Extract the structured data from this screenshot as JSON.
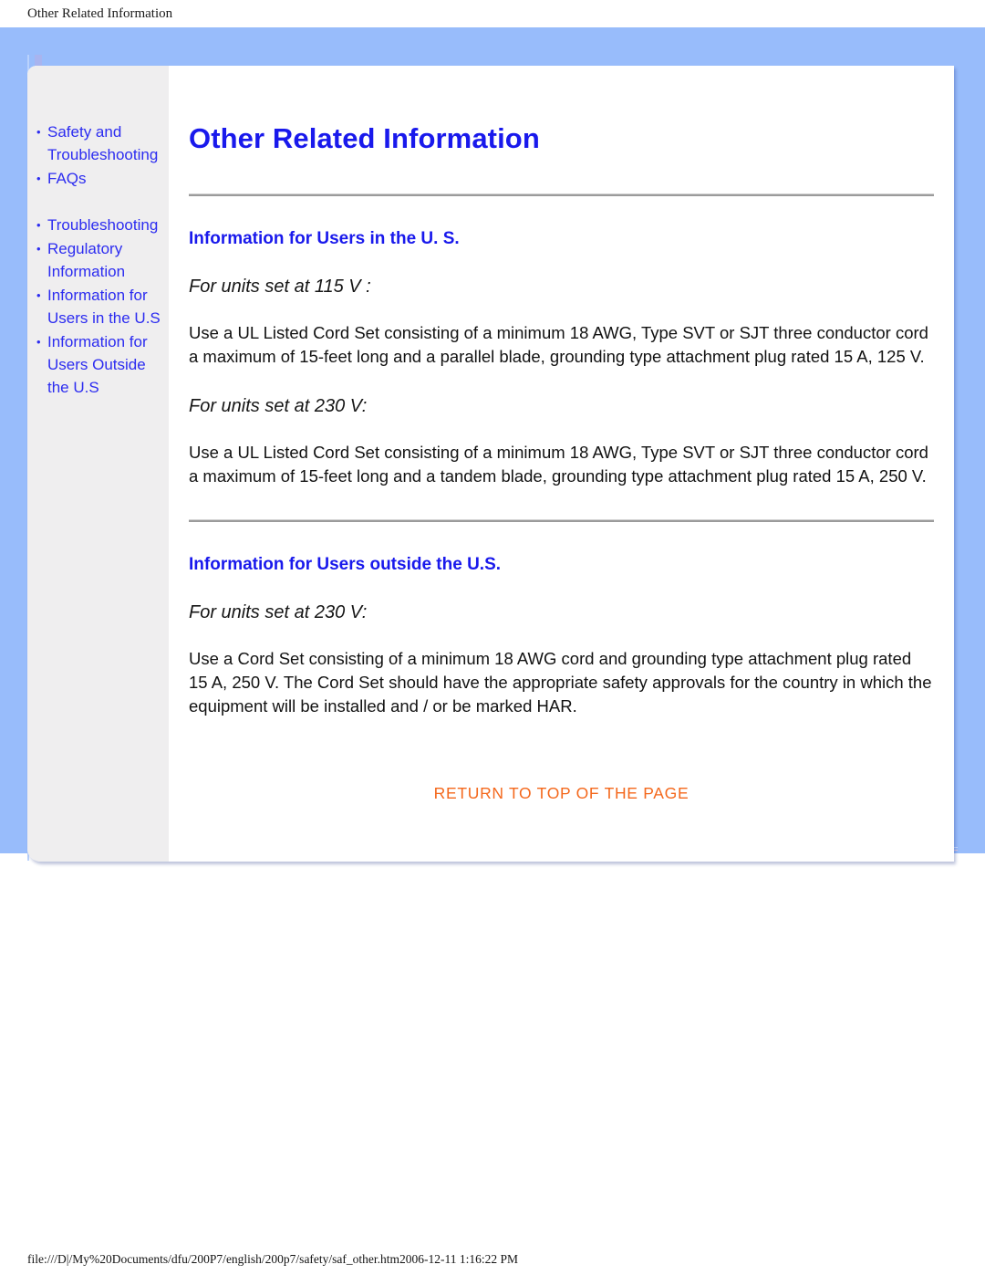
{
  "print_header": {
    "title": "Other Related Information"
  },
  "sidebar": {
    "groups": [
      {
        "items": [
          {
            "label": "Safety and Troubleshooting"
          },
          {
            "label": "FAQs"
          }
        ]
      },
      {
        "items": [
          {
            "label": "Troubleshooting"
          },
          {
            "label": "Regulatory Information"
          },
          {
            "label": "Information for Users in the U.S"
          },
          {
            "label": "Information for Users Outside the U.S"
          }
        ]
      }
    ]
  },
  "main": {
    "page_title": "Other Related Information",
    "sections": [
      {
        "heading": "Information for Users in the U. S.",
        "blocks": [
          {
            "sub_heading": "For units set at 115 V :"
          },
          {
            "paragraph": "Use a UL Listed Cord Set consisting of a minimum 18 AWG, Type SVT or SJT three conductor cord a maximum of 15-feet long and a parallel blade, grounding type attachment plug rated 15 A, 125 V."
          },
          {
            "sub_heading": "For units set at 230 V:"
          },
          {
            "paragraph": "Use a UL Listed Cord Set consisting of a minimum 18 AWG, Type SVT or SJT three conductor cord a maximum of 15-feet long and a tandem blade, grounding type attachment plug rated 15 A, 250 V."
          }
        ]
      },
      {
        "heading": "Information for Users outside the U.S.",
        "blocks": [
          {
            "sub_heading": "For units set at 230 V:"
          },
          {
            "paragraph": "Use a Cord Set consisting of a minimum 18 AWG cord and grounding type attachment plug rated 15 A, 250 V. The Cord Set should have the appropriate safety approvals for the country in which the equipment will be installed and / or be marked HAR."
          }
        ]
      }
    ],
    "return_link": "RETURN TO TOP OF THE PAGE"
  },
  "footer": {
    "path": "file:///D|/My%20Documents/dfu/200P7/english/200p7/safety/saf_other.htm2006-12-11 1:16:22 PM"
  },
  "colors": {
    "frame_blue": "#98bcfb",
    "sidebar_bg": "#efeeef",
    "link_blue": "#2c2cf0",
    "heading_blue": "#1919ec",
    "return_orange": "#f4681c",
    "rule_gray": "#9b9b9b"
  }
}
